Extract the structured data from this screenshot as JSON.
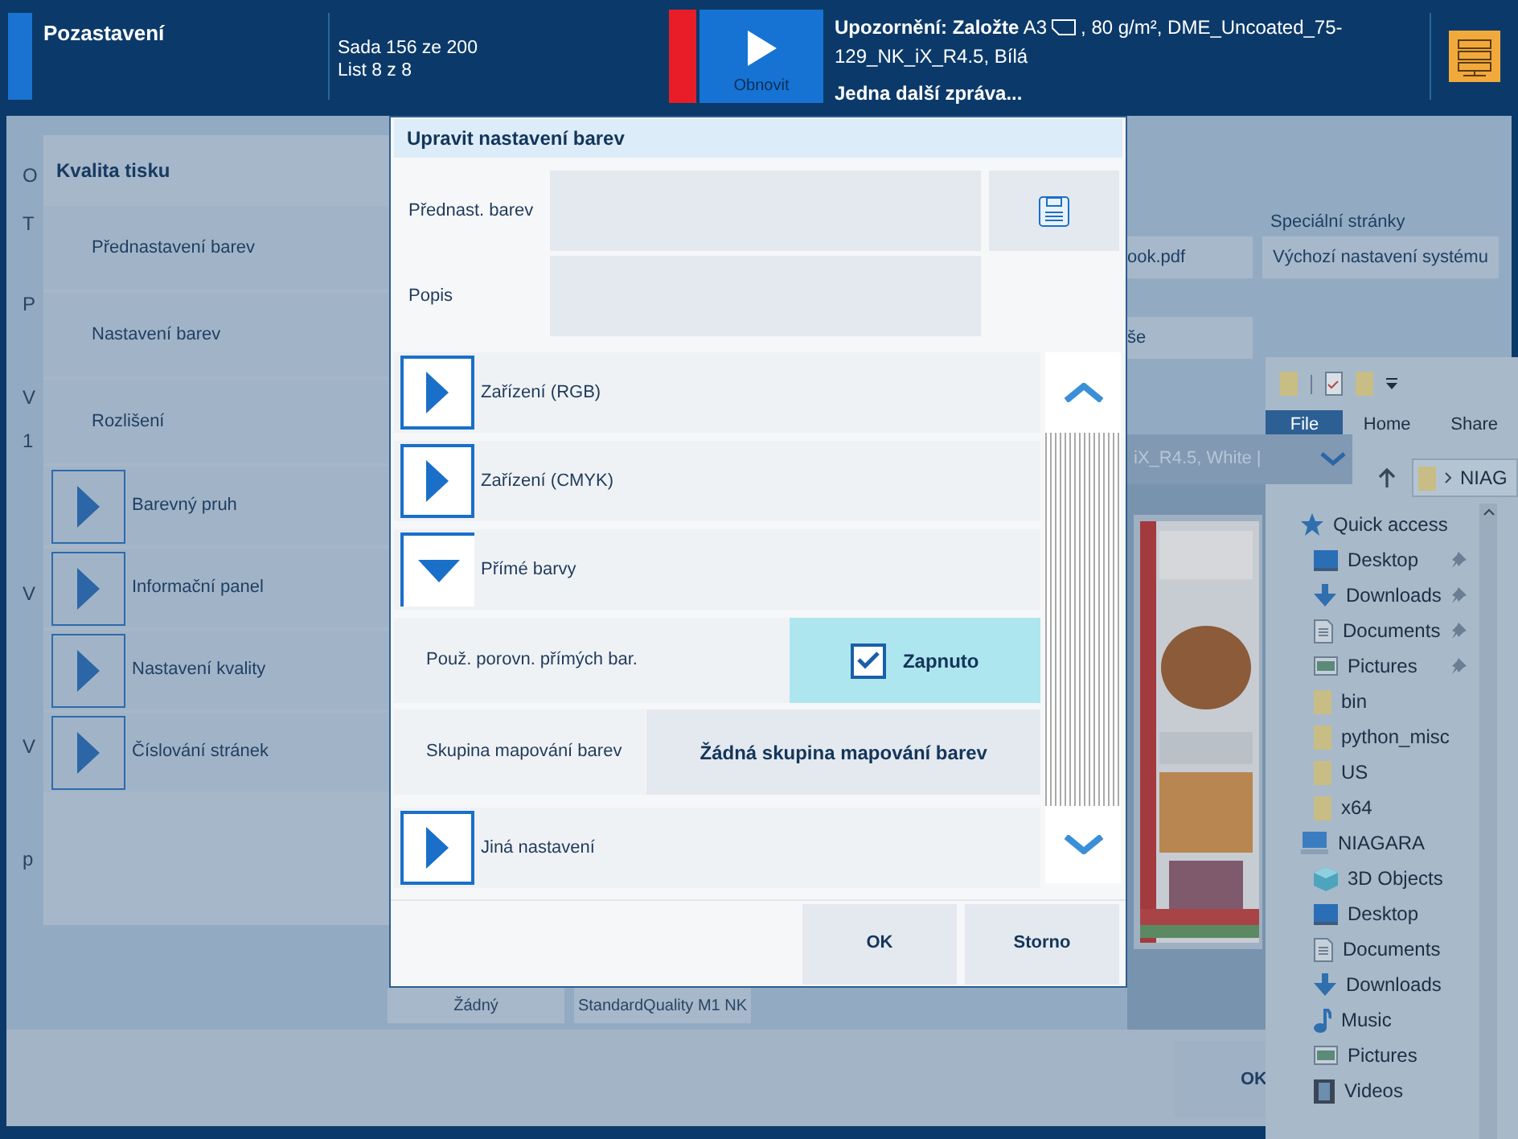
{
  "status_bar": {
    "title": "Pozastavení",
    "set": "Sada 156 ze 200",
    "sheet": "List 8 z 8",
    "resume_button": "Obnovit",
    "warning": {
      "label": "Upozornění: Založte",
      "size": "A3",
      "details": ", 80 g/m², DME_Uncoated_75-129_NK_iX_R4.5, Bílá"
    },
    "more_messages": "Jedna další zpráva..."
  },
  "background": {
    "left_labels": [
      "O",
      "T",
      "P",
      "V",
      "1",
      "V",
      "V",
      "p"
    ],
    "special_pages_label": "Speciální stránky",
    "special_pages_value": "Výchozí nastavení systému",
    "file_value": "ook.pdf",
    "value_2": "še",
    "media_value": "iX_R4.5, White |",
    "bottom_values": [
      "Žádný",
      "StandardQuality M1 NK"
    ],
    "ok_button": "OK"
  },
  "print_quality": {
    "title": "Kvalita tisku",
    "items": [
      {
        "kind": "plain",
        "label": "Přednastavení barev"
      },
      {
        "kind": "plain",
        "label": "Nastavení barev"
      },
      {
        "kind": "plain",
        "label": "Rozlišení"
      },
      {
        "kind": "expander",
        "label": "Barevný pruh",
        "expanded": false
      },
      {
        "kind": "expander",
        "label": "Informační panel",
        "expanded": false
      },
      {
        "kind": "expander",
        "label": "Nastavení kvality",
        "expanded": false
      },
      {
        "kind": "expander",
        "label": "Číslování stránek",
        "expanded": false
      }
    ]
  },
  "dialog": {
    "title": "Upravit nastavení barev",
    "fields": [
      {
        "label": "Přednast. barev"
      },
      {
        "label": "Popis"
      }
    ],
    "sections": [
      {
        "kind": "expander",
        "label": "Zařízení (RGB)",
        "expanded": false
      },
      {
        "kind": "expander",
        "label": "Zařízení (CMYK)",
        "expanded": false
      },
      {
        "kind": "expander",
        "label": "Přímé barvy",
        "expanded": true
      },
      {
        "kind": "toggle",
        "label": "Použ. porovn. přímých bar.",
        "checked": true,
        "value": "Zapnuto"
      },
      {
        "kind": "choice",
        "label": "Skupina mapování barev",
        "value": "Žádná skupina mapování barev"
      },
      {
        "kind": "expander",
        "label": "Jiná nastavení",
        "expanded": false
      }
    ],
    "buttons": [
      "OK",
      "Storno"
    ]
  },
  "explorer": {
    "tabs": [
      {
        "label": "File",
        "selected": true
      },
      {
        "label": "Home",
        "selected": false
      },
      {
        "label": "Share",
        "selected": false
      }
    ],
    "address": "NIAG",
    "tree": [
      {
        "label": "Quick access",
        "kind": "star",
        "children": [
          {
            "label": "Desktop",
            "kind": "desktop",
            "pinned": true
          },
          {
            "label": "Downloads",
            "kind": "download",
            "pinned": true
          },
          {
            "label": "Documents",
            "kind": "document",
            "pinned": true
          },
          {
            "label": "Pictures",
            "kind": "pictures",
            "pinned": true
          },
          {
            "label": "bin",
            "kind": "folder",
            "pinned": false
          },
          {
            "label": "python_misc",
            "kind": "folder",
            "pinned": false
          },
          {
            "label": "US",
            "kind": "folder",
            "pinned": false
          },
          {
            "label": "x64",
            "kind": "folder",
            "pinned": false
          }
        ]
      },
      {
        "label": "NIAGARA",
        "kind": "computer",
        "children": [
          {
            "label": "3D Objects",
            "kind": "cube"
          },
          {
            "label": "Desktop",
            "kind": "desktop"
          },
          {
            "label": "Documents",
            "kind": "document"
          },
          {
            "label": "Downloads",
            "kind": "download"
          },
          {
            "label": "Music",
            "kind": "music"
          },
          {
            "label": "Pictures",
            "kind": "pictures"
          },
          {
            "label": "Videos",
            "kind": "video"
          }
        ]
      }
    ]
  }
}
